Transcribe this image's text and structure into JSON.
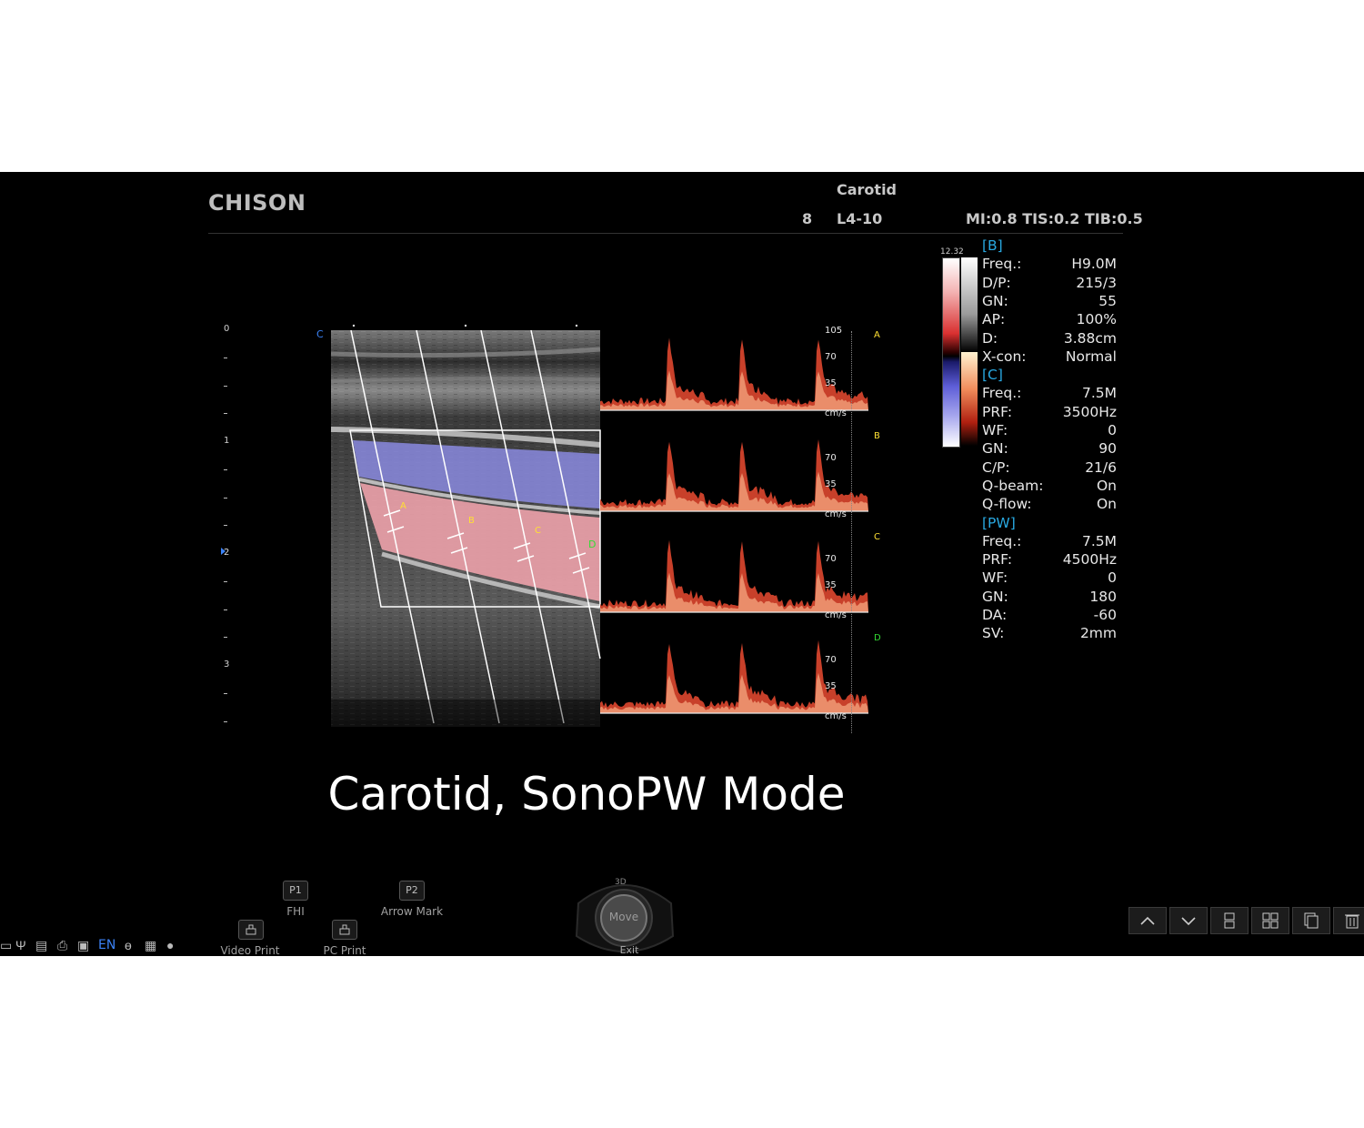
{
  "header": {
    "brand": "CHISON",
    "exam": "Carotid",
    "probe_index": "8",
    "probe": "L4-10",
    "safety": "MI:0.8 TIS:0.2 TIB:0.5"
  },
  "colorbar": {
    "velocity_max": "12.32"
  },
  "params": {
    "b": {
      "title": "[B]",
      "rows": [
        {
          "k": "Freq.:",
          "v": "H9.0M"
        },
        {
          "k": "D/P:",
          "v": "215/3"
        },
        {
          "k": "GN:",
          "v": "55"
        },
        {
          "k": "AP:",
          "v": "100%"
        },
        {
          "k": "D:",
          "v": "3.88cm"
        },
        {
          "k": "X-con:",
          "v": "Normal"
        }
      ]
    },
    "c": {
      "title": "[C]",
      "rows": [
        {
          "k": "Freq.:",
          "v": "7.5M"
        },
        {
          "k": "PRF:",
          "v": "3500Hz"
        },
        {
          "k": "WF:",
          "v": "0"
        },
        {
          "k": "GN:",
          "v": "90"
        },
        {
          "k": "C/P:",
          "v": "21/6"
        },
        {
          "k": "Q-beam:",
          "v": "On"
        },
        {
          "k": "Q-flow:",
          "v": "On"
        }
      ]
    },
    "pw": {
      "title": "[PW]",
      "rows": [
        {
          "k": "Freq.:",
          "v": "7.5M"
        },
        {
          "k": "PRF:",
          "v": "4500Hz"
        },
        {
          "k": "WF:",
          "v": "0"
        },
        {
          "k": "GN:",
          "v": "180"
        },
        {
          "k": "DA:",
          "v": "-60"
        },
        {
          "k": "SV:",
          "v": "2mm"
        }
      ]
    }
  },
  "depth_scale": {
    "labels": [
      "0",
      "1",
      "2",
      "3"
    ]
  },
  "image": {
    "corner_label": "C",
    "gate_labels": [
      "A",
      "B",
      "C",
      "D"
    ]
  },
  "traces": [
    {
      "label": "A",
      "scale": [
        "105",
        "70",
        "35"
      ],
      "unit": "cm/s",
      "color": "#ffe033"
    },
    {
      "label": "B",
      "scale": [
        "70",
        "35"
      ],
      "unit": "cm/s",
      "color": "#ffe033"
    },
    {
      "label": "C",
      "scale": [
        "70",
        "35"
      ],
      "unit": "cm/s",
      "color": "#ffe033"
    },
    {
      "label": "D",
      "scale": [
        "70",
        "35"
      ],
      "unit": "cm/s",
      "color": "#33dd33"
    }
  ],
  "caption": "Carotid, SonoPW Mode",
  "softkeys": {
    "p1": {
      "key": "P1",
      "label": "FHI"
    },
    "p2": {
      "key": "P2",
      "label": "Arrow Mark"
    },
    "video_print": "Video Print",
    "pc_print": "PC Print"
  },
  "trackball": {
    "top": "3D",
    "center": "Move",
    "bottom": "Exit"
  },
  "status": {
    "language": "EN"
  }
}
